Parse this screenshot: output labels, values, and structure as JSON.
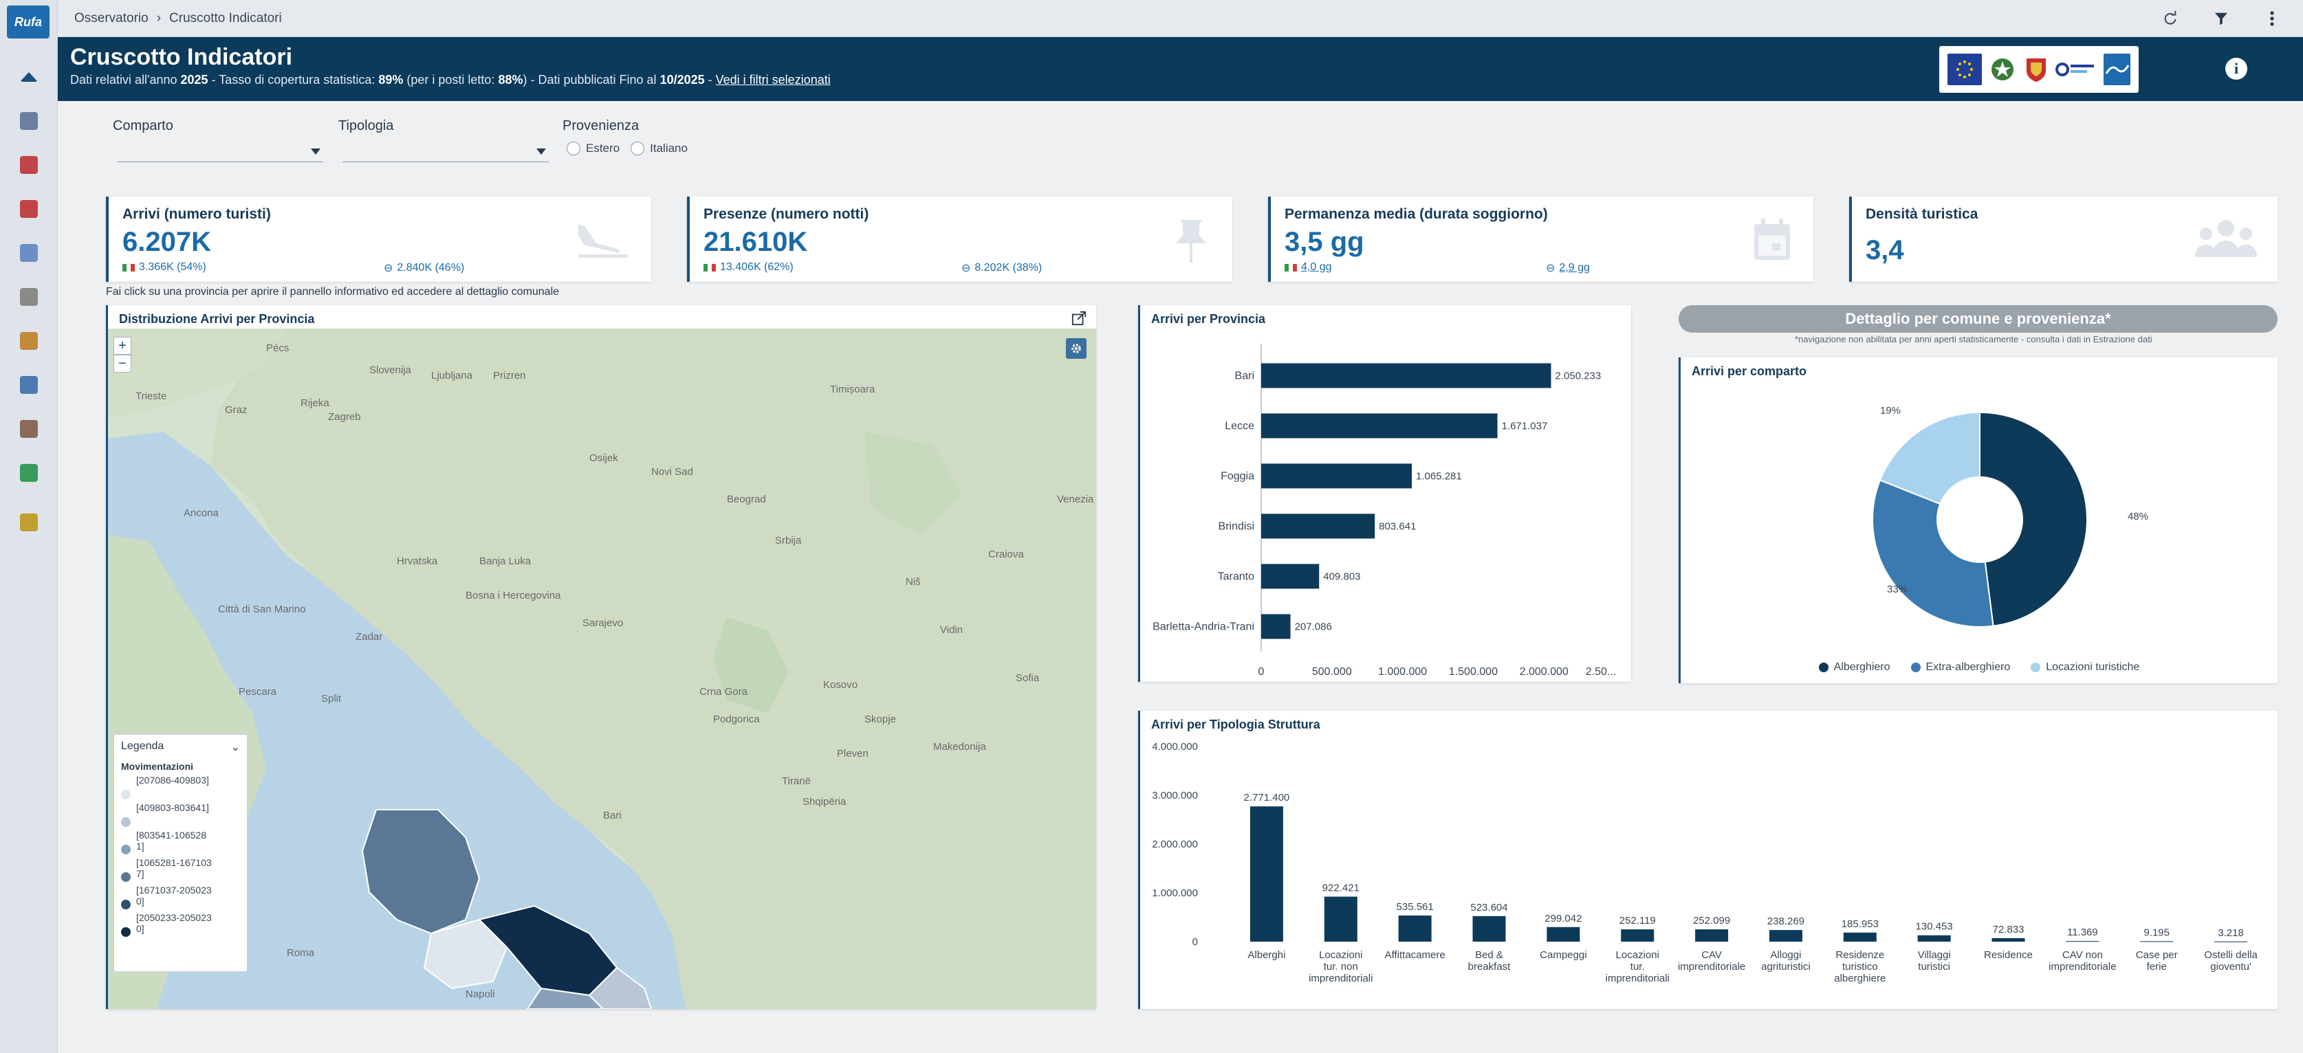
{
  "app": {
    "logo_text": "Rufa"
  },
  "sidebar": {
    "items": [
      {
        "name": "home-icon",
        "color": "#1b4f7a"
      },
      {
        "name": "chart-icon",
        "color": "#6b7fa3"
      },
      {
        "name": "search-map-icon",
        "color": "#c0444a"
      },
      {
        "name": "briefcase-icon",
        "color": "#c04444"
      },
      {
        "name": "building-icon",
        "color": "#6b8fc4"
      },
      {
        "name": "satellite-icon",
        "color": "#8a8a8a"
      },
      {
        "name": "globe-icon",
        "color": "#c08a3a"
      },
      {
        "name": "map-icon",
        "color": "#4a7ab0"
      },
      {
        "name": "monitor-icon",
        "color": "#8a6a5a"
      },
      {
        "name": "database-icon",
        "color": "#3a9a5a"
      },
      {
        "name": "swap-icon",
        "color": "#c0a030"
      }
    ]
  },
  "breadcrumb": {
    "root": "Osservatorio",
    "separator": "›",
    "current": "Cruscotto Indicatori"
  },
  "header": {
    "title": "Cruscotto Indicatori",
    "sub_1": "Dati relativi all'anno ",
    "year": "2025",
    "sub_2": " - Tasso di copertura statistica: ",
    "coverage": "89%",
    "sub_3": " (per i posti letto: ",
    "coverage_beds": "88%",
    "sub_4": ") - Dati pubblicati Fino al ",
    "published": "10/2025",
    "sub_5": " - ",
    "filters_link": "Vedi i filtri selezionati"
  },
  "filters": {
    "comparto_label": "Comparto",
    "tipologia_label": "Tipologia",
    "provenienza_label": "Provenienza",
    "radio_estero": "Estero",
    "radio_italiano": "Italiano"
  },
  "kpis": [
    {
      "title": "Arrivi (numero turisti)",
      "value": "6.207K",
      "it": "3.366K (54%)",
      "foreign": "2.840K (46%)",
      "icon": "plane-landing-icon"
    },
    {
      "title": "Presenze (numero notti)",
      "value": "21.610K",
      "it": "13.406K (62%)",
      "foreign": "8.202K (38%)",
      "icon": "pin-icon"
    },
    {
      "title": "Permanenza media (durata soggiorno)",
      "value": "3,5 gg",
      "it": "4,0 gg",
      "foreign": "2,9 gg",
      "icon": "calendar-icon"
    },
    {
      "title": "Densità turistica",
      "value": "3,4",
      "icon": "people-icon"
    }
  ],
  "hint": "Fai click su una provincia per aprire il pannello informativo ed accedere al dettaglio comunale",
  "map_panel": {
    "title": "Distribuzione Arrivi per Provincia",
    "zoom_in": "+",
    "zoom_out": "−",
    "legend_title": "Legenda",
    "legend_subtitle": "Movimentazioni",
    "legend_items": [
      {
        "label": "[207086-409803]",
        "color": "#dfe6ee"
      },
      {
        "label": "[409803-803641]",
        "color": "#b8c6d6"
      },
      {
        "label": "[803541-1065281]",
        "color": "#8aa0b8"
      },
      {
        "label": "[1065281-1671037]",
        "color": "#5a7896"
      },
      {
        "label": "[1671037-2050230]",
        "color": "#2e4f70"
      },
      {
        "label": "[2050233-2050230]",
        "color": "#0f2d4a"
      }
    ],
    "place_labels": [
      "Slovenija",
      "Zagreb",
      "Hrvatska",
      "Bosna i Hercegovina",
      "Novi Sad",
      "Beograd",
      "Srbija",
      "Crna Gora",
      "Kosovo",
      "Sarajevo",
      "Split",
      "Timișoara",
      "Sofia",
      "Skopje",
      "Tiranë",
      "Ljubljana",
      "Shqipëria",
      "Makedonija",
      "Città di San Marino",
      "Ancona",
      "Pescara",
      "Roma",
      "Bari",
      "Napoli",
      "Podgorica",
      "Niš",
      "Banja Luka",
      "Rijeka",
      "Zadar",
      "Osijek",
      "Pécs",
      "Graz",
      "Trieste",
      "Venezia",
      "Craiova",
      "Vidin",
      "Pleven",
      "Prizren"
    ]
  },
  "province_chart": {
    "title": "Arrivi per Provincia",
    "chart_data": {
      "type": "bar",
      "orientation": "horizontal",
      "categories": [
        "Bari",
        "Lecce",
        "Foggia",
        "Brindisi",
        "Taranto",
        "Barletta-Andria-Trani"
      ],
      "values": [
        2050233,
        1671037,
        1065281,
        803641,
        409803,
        207086
      ],
      "value_labels": [
        "2.050.233",
        "1.671.037",
        "1.065.281",
        "803.641",
        "409.803",
        "207.086"
      ],
      "x_ticks": [
        "0",
        "500.000",
        "1.000.000",
        "1.500.000",
        "2.000.000",
        "2.50..."
      ],
      "xlim": [
        0,
        2500000
      ],
      "color": "#0e3a5a"
    }
  },
  "pill": {
    "title": "Dettaglio per comune e provenienza*",
    "note": "*navigazione non abilitata per anni aperti statisticamente - consulta i dati in Estrazione dati"
  },
  "comparto_chart": {
    "title": "Arrivi per comparto",
    "chart_data": {
      "type": "pie",
      "donut": true,
      "labels": [
        "Alberghiero",
        "Extra-alberghiero",
        "Locazioni turistiche"
      ],
      "values": [
        48,
        33,
        19
      ],
      "value_labels": [
        "48%",
        "33%",
        "19%"
      ],
      "colors": [
        "#0e3a5a",
        "#3b7ab0",
        "#a8d2ee"
      ]
    }
  },
  "tipologia_chart": {
    "title": "Arrivi per Tipologia Struttura",
    "chart_data": {
      "type": "bar",
      "categories": [
        "Alberghi",
        "Locazioni tur. non imprenditoriali",
        "Affittacamere",
        "Bed & breakfast",
        "Campeggi",
        "Locazioni tur. imprenditoriali",
        "CAV imprenditoriale",
        "Alloggi agrituristici",
        "Residenze turistico alberghiere",
        "Villaggi turistici",
        "Residence",
        "CAV non imprenditoriale",
        "Case per ferie",
        "Ostelli della gioventu'"
      ],
      "values": [
        2771400,
        922421,
        535561,
        523604,
        299042,
        252119,
        252099,
        238269,
        185953,
        130453,
        72833,
        11369,
        9195,
        3218
      ],
      "value_labels": [
        "2.771.400",
        "922.421",
        "535.561",
        "523.604",
        "299.042",
        "252.119",
        "252.099",
        "238.269",
        "185.953",
        "130.453",
        "72.833",
        "11.369",
        "9.195",
        "3.218"
      ],
      "y_ticks": [
        "4.000.000",
        "3.000.000",
        "2.000.000",
        "1.000.000",
        "0"
      ],
      "ylim": [
        0,
        4000000
      ],
      "color": "#0e3a5a"
    }
  }
}
